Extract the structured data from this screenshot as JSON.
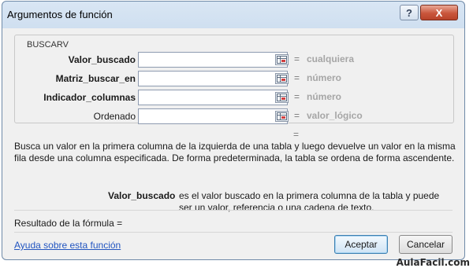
{
  "window": {
    "title": "Argumentos de función",
    "help_label": "?",
    "close_label": "X"
  },
  "group": {
    "title": "BUSCARV",
    "args": [
      {
        "label": "Valor_buscado",
        "bold": true,
        "value": "",
        "eq": "=",
        "hint": "cualquiera"
      },
      {
        "label": "Matriz_buscar_en",
        "bold": true,
        "value": "",
        "eq": "=",
        "hint": "número"
      },
      {
        "label": "Indicador_columnas",
        "bold": true,
        "value": "",
        "eq": "=",
        "hint": "número"
      },
      {
        "label": "Ordenado",
        "bold": false,
        "value": "",
        "eq": "=",
        "hint": "valor_lógico"
      }
    ]
  },
  "result_eq": "=",
  "description": "Busca un valor en la primera columna de la izquierda de una tabla y luego devuelve un valor en la misma fila desde una columna especificada. De forma predeterminada, la tabla se ordena de forma ascendente.",
  "param": {
    "name": "Valor_buscado",
    "description": "es el valor buscado en la primera columna de la tabla y puede ser un valor, referencia o una cadena de texto."
  },
  "formula_result": "Resultado de la fórmula =",
  "help_link": "Ayuda sobre esta función",
  "buttons": {
    "accept": "Aceptar",
    "cancel": "Cancelar"
  },
  "watermark": "AulaFacil.com"
}
